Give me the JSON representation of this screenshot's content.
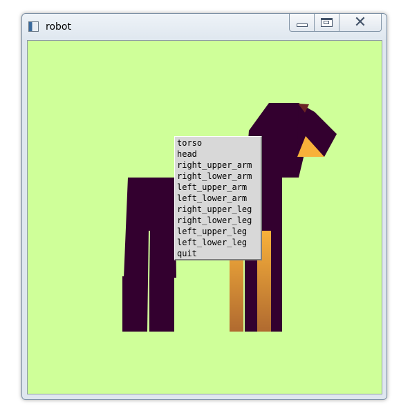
{
  "window": {
    "title": "robot",
    "icon": "app-window-icon"
  },
  "titlebar_controls": {
    "minimize": "minimize-icon",
    "maximize": "maximize-icon",
    "close": "close-icon",
    "close_glyph": "✕"
  },
  "canvas": {
    "background_color": "#cfff99",
    "robot_color": "#33002f",
    "accent_color": "#f8b13a"
  },
  "menu": {
    "items": [
      "torso",
      "head",
      "right_upper_arm",
      "right_lower_arm",
      "left_upper_arm",
      "left_lower_arm",
      "right_upper_leg",
      "right_lower_leg",
      "left_upper_leg",
      "left_lower_leg",
      "quit"
    ]
  }
}
